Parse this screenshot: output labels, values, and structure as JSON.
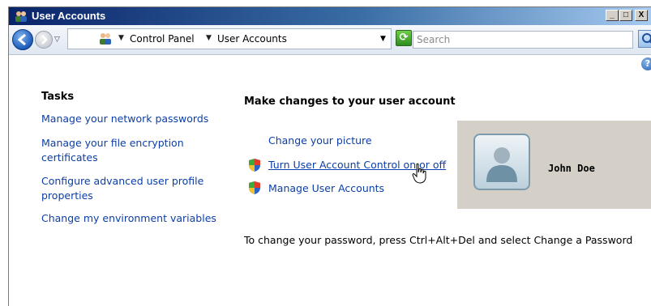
{
  "window": {
    "title": "User Accounts"
  },
  "controls": {
    "minimize": "_",
    "maximize": "□",
    "close": "X"
  },
  "address": {
    "crumbs": [
      "Control Panel",
      "User Accounts"
    ]
  },
  "search": {
    "placeholder": "Search"
  },
  "tasks": {
    "heading": "Tasks",
    "links": [
      "Manage your network passwords",
      "Manage your file encryption certificates",
      "Configure advanced user profile properties",
      "Change my environment variables"
    ]
  },
  "main": {
    "heading": "Make changes to your user account",
    "change_picture": "Change your picture",
    "uac": "Turn User Account Control on or off",
    "manage_accounts": "Manage User Accounts",
    "password_note": "To change your password, press Ctrl+Alt+Del and select Change a Password"
  },
  "user": {
    "name": "John Doe"
  },
  "colors": {
    "link": "#0b3ea8",
    "user_panel": "#d4d0c8",
    "title_bar": "#0a246a"
  }
}
